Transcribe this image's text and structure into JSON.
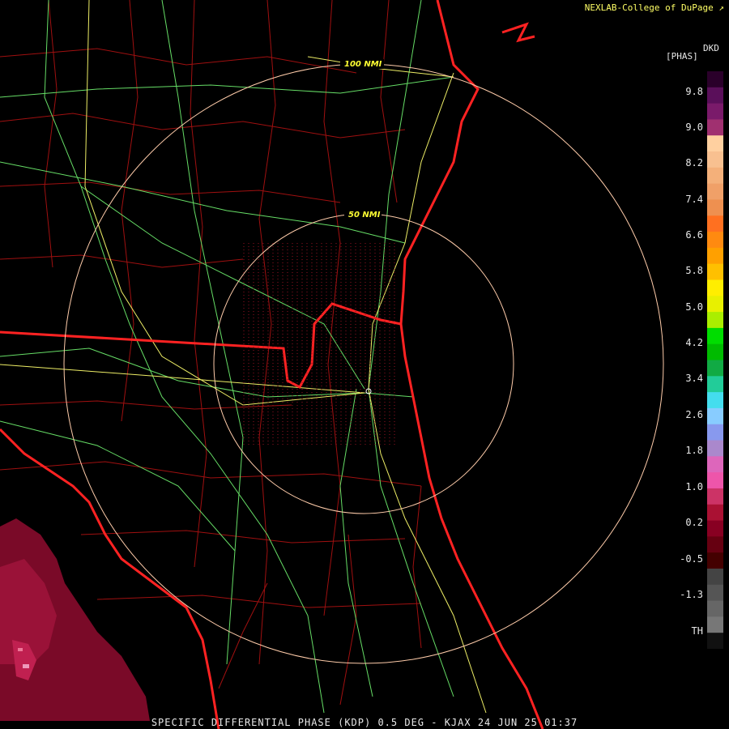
{
  "credit": "NEXLAB-College of DuPage",
  "legend": {
    "product": "DKD",
    "unit": "[PHAS]",
    "ticks": [
      "9.8",
      "9.0",
      "8.2",
      "7.4",
      "6.6",
      "5.8",
      "5.0",
      "4.2",
      "3.4",
      "2.6",
      "1.8",
      "1.0",
      "0.2",
      "-0.5",
      "-1.3",
      "TH"
    ],
    "colors": [
      "#2a002a",
      "#5a0f5a",
      "#7a1a6a",
      "#a03070",
      "#ffd0a0",
      "#f8c090",
      "#f4b07a",
      "#f0a068",
      "#ee9050",
      "#ff7020",
      "#ff8a10",
      "#ffa000",
      "#ffc000",
      "#ffee00",
      "#e8f000",
      "#aaee00",
      "#00dd00",
      "#00bb00",
      "#11aa44",
      "#22cc99",
      "#44ddee",
      "#88ccff",
      "#8899ee",
      "#aa88cc",
      "#dd66bb",
      "#ee55aa",
      "#cc3366",
      "#aa1133",
      "#880022",
      "#660011",
      "#440000",
      "#444444",
      "#555555",
      "#666666",
      "#777777",
      "#111111"
    ]
  },
  "range_rings": [
    {
      "label": "50 NMI"
    },
    {
      "label": "100 NMI"
    }
  ],
  "footer": "SPECIFIC DIFFERENTIAL PHASE (KDP) 0.5 DEG - KJAX 24 JUN 25 01:37"
}
